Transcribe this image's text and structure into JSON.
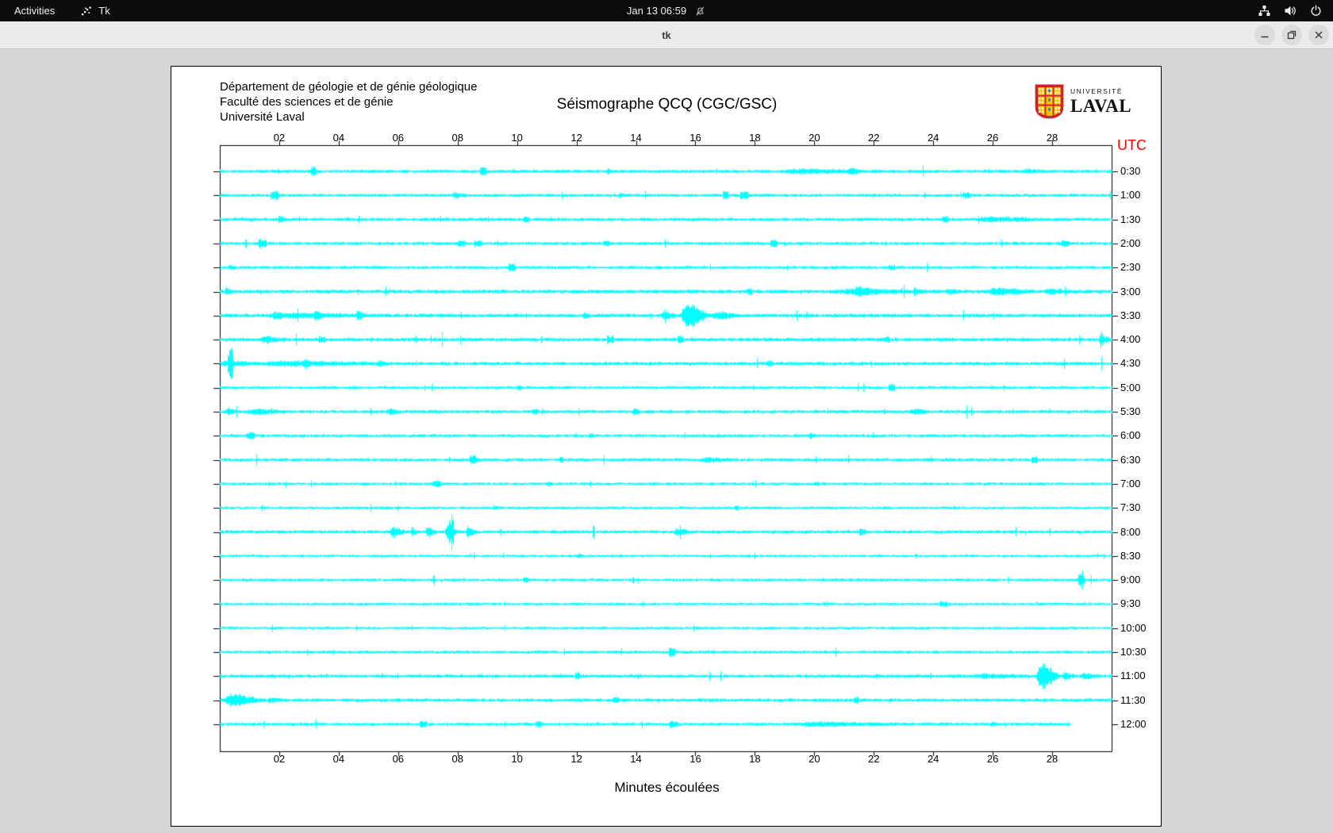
{
  "top_bar": {
    "activities": "Activities",
    "app_name": "Tk",
    "clock": "Jan 13 06:59",
    "icons": [
      "tk-app-icon",
      "bell-slash-icon",
      "network-icon",
      "volume-icon",
      "power-icon"
    ]
  },
  "title_bar": {
    "title": "tk",
    "buttons": [
      "minimize",
      "maximize",
      "close"
    ]
  },
  "window": {
    "header_lines": [
      "Département de géologie et de génie géologique",
      "Faculté des sciences et de génie",
      "Université Laval"
    ],
    "title": "Séismographe QCQ (CGC/GSC)",
    "logo": {
      "line1": "UNIVERSITÉ",
      "line2": "LAVAL",
      "shield_gold": "#f6c500",
      "shield_red": "#d21f2e",
      "dot_blue": "#1f7ac4"
    },
    "utc_label": "UTC",
    "xlabel": "Minutes écoulées"
  },
  "chart_data": {
    "type": "line",
    "title": "Séismographe QCQ (CGC/GSC)",
    "xlabel": "Minutes écoulées",
    "x_range": [
      0,
      30
    ],
    "x_ticks": [
      "02",
      "04",
      "06",
      "08",
      "10",
      "12",
      "14",
      "16",
      "18",
      "20",
      "22",
      "24",
      "26",
      "28"
    ],
    "row_labels": [
      "0:30",
      "1:00",
      "1:30",
      "2:00",
      "2:30",
      "3:00",
      "3:30",
      "4:00",
      "4:30",
      "5:00",
      "5:30",
      "6:00",
      "6:30",
      "7:00",
      "7:30",
      "8:00",
      "8:30",
      "9:00",
      "9:30",
      "10:00",
      "10:30",
      "11:00",
      "11:30",
      "12:00"
    ],
    "trace_color": "#00ffff",
    "axis_color": "#000000",
    "utc_color": "#ff0000",
    "last_row_end_minute": 28.6,
    "base_amp": [
      1.3,
      1.25,
      1.3,
      1.25,
      1.2,
      1.5,
      1.5,
      1.45,
      1.45,
      1.15,
      1.35,
      1.2,
      1.25,
      1.1,
      1.05,
      1.35,
      1.05,
      1.15,
      1.05,
      1.05,
      1.15,
      1.35,
      1.35,
      1.25
    ],
    "events": [
      [
        0,
        3.05,
        3.25,
        4.5
      ],
      [
        0,
        8.75,
        8.95,
        4
      ],
      [
        0,
        13.0,
        13.15,
        2.5
      ],
      [
        0,
        18.8,
        22.6,
        2.2
      ],
      [
        0,
        21.1,
        21.6,
        3.2
      ],
      [
        0,
        27.0,
        27.6,
        2.2
      ],
      [
        1,
        1.7,
        1.95,
        4.5
      ],
      [
        1,
        7.8,
        8.25,
        3.5
      ],
      [
        1,
        13.4,
        13.7,
        2.5
      ],
      [
        1,
        16.9,
        17.1,
        3.5
      ],
      [
        1,
        17.5,
        17.75,
        4.5
      ],
      [
        1,
        25.0,
        25.2,
        2.5
      ],
      [
        2,
        1.95,
        2.2,
        5.5
      ],
      [
        2,
        10.2,
        10.4,
        2.2
      ],
      [
        2,
        24.3,
        24.5,
        3
      ],
      [
        2,
        25.3,
        28.6,
        2.4
      ],
      [
        3,
        1.3,
        1.55,
        5
      ],
      [
        3,
        8.0,
        8.2,
        3
      ],
      [
        3,
        8.55,
        8.8,
        3.2
      ],
      [
        3,
        12.9,
        13.1,
        2.4
      ],
      [
        3,
        18.5,
        18.75,
        3
      ],
      [
        3,
        28.3,
        28.55,
        3
      ],
      [
        4,
        0.3,
        0.5,
        2
      ],
      [
        4,
        9.7,
        9.95,
        4.5
      ],
      [
        4,
        22.5,
        22.7,
        2.2
      ],
      [
        5,
        0.15,
        0.5,
        4
      ],
      [
        5,
        17.7,
        17.9,
        3
      ],
      [
        5,
        20.6,
        24.2,
        2.6
      ],
      [
        5,
        21.3,
        22.3,
        4.2
      ],
      [
        5,
        23.3,
        23.6,
        3.5
      ],
      [
        5,
        24.4,
        25.0,
        3
      ],
      [
        5,
        25.8,
        27.7,
        3.8
      ],
      [
        5,
        27.7,
        28.6,
        2.4
      ],
      [
        6,
        1.5,
        5.8,
        2.4
      ],
      [
        6,
        1.75,
        2.15,
        4
      ],
      [
        6,
        3.15,
        3.5,
        4
      ],
      [
        6,
        4.55,
        4.95,
        4
      ],
      [
        6,
        12.2,
        12.4,
        2.5
      ],
      [
        6,
        14.8,
        15.5,
        4.5
      ],
      [
        6,
        15.5,
        16.5,
        20
      ],
      [
        6,
        16.5,
        17.6,
        5
      ],
      [
        7,
        1.3,
        2.3,
        3.8
      ],
      [
        7,
        3.3,
        3.5,
        2.5
      ],
      [
        7,
        13.0,
        13.25,
        3.5
      ],
      [
        7,
        15.4,
        15.6,
        3.5
      ],
      [
        7,
        22.3,
        22.5,
        2.5
      ],
      [
        7,
        29.55,
        29.95,
        9
      ],
      [
        8,
        0.0,
        1.2,
        3
      ],
      [
        8,
        0.25,
        0.45,
        20
      ],
      [
        8,
        1.2,
        6.2,
        2.2
      ],
      [
        8,
        2.8,
        3.1,
        3.5
      ],
      [
        8,
        5.3,
        5.6,
        3.2
      ],
      [
        8,
        18.4,
        18.6,
        3
      ],
      [
        9,
        10.0,
        10.15,
        2
      ],
      [
        9,
        22.5,
        22.7,
        3.8
      ],
      [
        10,
        0.2,
        0.6,
        3.5
      ],
      [
        10,
        0.9,
        2.4,
        2.8
      ],
      [
        10,
        5.6,
        6.1,
        3.8
      ],
      [
        10,
        10.5,
        10.7,
        2.8
      ],
      [
        10,
        13.9,
        14.1,
        3
      ],
      [
        10,
        23.2,
        23.9,
        3.2
      ],
      [
        11,
        0.9,
        1.15,
        3.8
      ],
      [
        11,
        12.4,
        12.55,
        2
      ],
      [
        11,
        19.8,
        20.1,
        3.2
      ],
      [
        12,
        8.4,
        8.65,
        4.5
      ],
      [
        12,
        11.4,
        11.55,
        2.2
      ],
      [
        12,
        16.1,
        17.4,
        2.6
      ],
      [
        12,
        27.3,
        27.5,
        3.5
      ],
      [
        13,
        7.15,
        7.4,
        3
      ],
      [
        13,
        11.0,
        11.15,
        2.2
      ],
      [
        13,
        20.0,
        20.15,
        2
      ],
      [
        14,
        9.2,
        9.35,
        2
      ],
      [
        14,
        17.3,
        17.45,
        2
      ],
      [
        15,
        5.7,
        6.3,
        7
      ],
      [
        15,
        6.4,
        6.7,
        5
      ],
      [
        15,
        6.9,
        7.3,
        7.5
      ],
      [
        15,
        7.55,
        8.05,
        8
      ],
      [
        15,
        7.7,
        7.85,
        18
      ],
      [
        15,
        8.25,
        8.65,
        7
      ],
      [
        15,
        15.25,
        15.95,
        4.5
      ],
      [
        15,
        21.5,
        21.7,
        3.2
      ],
      [
        16,
        12.0,
        12.15,
        2
      ],
      [
        17,
        10.2,
        10.35,
        2
      ],
      [
        17,
        28.85,
        29.15,
        11
      ],
      [
        18,
        24.2,
        24.45,
        2.2
      ],
      [
        19,
        16.0,
        16.1,
        1.5
      ],
      [
        20,
        15.1,
        15.3,
        6.5
      ],
      [
        21,
        11.95,
        12.1,
        3
      ],
      [
        21,
        25.3,
        27.4,
        2.2
      ],
      [
        21,
        27.45,
        28.3,
        19
      ],
      [
        21,
        28.3,
        28.9,
        4.5
      ],
      [
        21,
        28.9,
        29.7,
        3.5
      ],
      [
        22,
        0.1,
        1.6,
        8
      ],
      [
        22,
        1.6,
        2.1,
        3
      ],
      [
        22,
        13.2,
        13.4,
        2.5
      ],
      [
        22,
        21.3,
        21.5,
        3.2
      ],
      [
        23,
        6.7,
        6.95,
        3
      ],
      [
        23,
        10.6,
        10.8,
        2.8
      ],
      [
        23,
        15.1,
        15.35,
        3.2
      ],
      [
        23,
        19.2,
        23.6,
        2.2
      ],
      [
        23,
        25.9,
        26.2,
        2.5
      ]
    ]
  }
}
